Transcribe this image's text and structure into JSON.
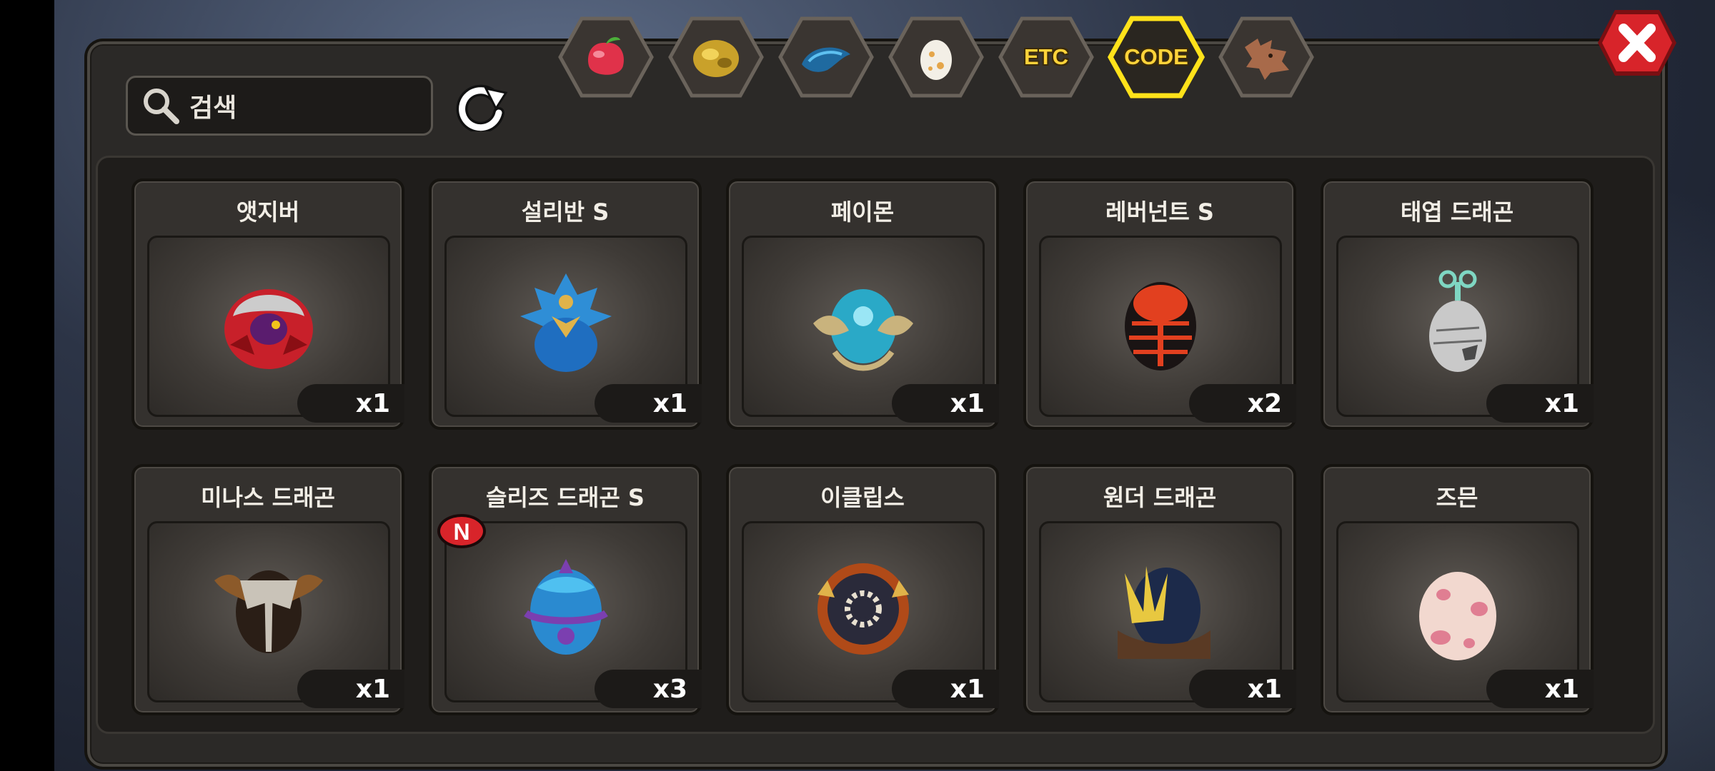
{
  "search": {
    "placeholder": "검색"
  },
  "tabs": [
    {
      "name": "fruit",
      "icon": "fruit-icon"
    },
    {
      "name": "gold",
      "icon": "gold-icon"
    },
    {
      "name": "scale",
      "icon": "scale-icon"
    },
    {
      "name": "egg",
      "icon": "egg-icon"
    },
    {
      "name": "etc",
      "label": "ETC"
    },
    {
      "name": "code",
      "label": "CODE",
      "selected": true
    },
    {
      "name": "dragon",
      "icon": "dragon-head-icon"
    }
  ],
  "items": [
    {
      "name": "앳지버",
      "qty": "x1",
      "colors": [
        "#c8202a",
        "#5a1c6e"
      ]
    },
    {
      "name": "설리반 S",
      "qty": "x1",
      "colors": [
        "#2f8ed6",
        "#e0b34a"
      ]
    },
    {
      "name": "페이몬",
      "qty": "x1",
      "colors": [
        "#2aa9c7",
        "#c9b37d"
      ]
    },
    {
      "name": "레버넌트 S",
      "qty": "x2",
      "colors": [
        "#e2401f",
        "#1a1414"
      ]
    },
    {
      "name": "태엽 드래곤",
      "qty": "x1",
      "colors": [
        "#c9c9c9",
        "#4a4a4a"
      ]
    },
    {
      "name": "미나스 드래곤",
      "qty": "x1",
      "colors": [
        "#8c5a2a",
        "#c9c3b8"
      ]
    },
    {
      "name": "슬리즈 드래곤 S",
      "qty": "x3",
      "colors": [
        "#2a8ad0",
        "#7b3fb0"
      ],
      "new": true
    },
    {
      "name": "이클립스",
      "qty": "x1",
      "colors": [
        "#b04a18",
        "#2a2a3a"
      ]
    },
    {
      "name": "원더 드래곤",
      "qty": "x1",
      "colors": [
        "#1c2a4a",
        "#e8c840"
      ]
    },
    {
      "name": "즈믄",
      "qty": "x1",
      "colors": [
        "#f2d8cf",
        "#e07e92"
      ]
    }
  ],
  "new_badge": "N",
  "accent": "#ffd33a",
  "close_color": "#d8242a"
}
